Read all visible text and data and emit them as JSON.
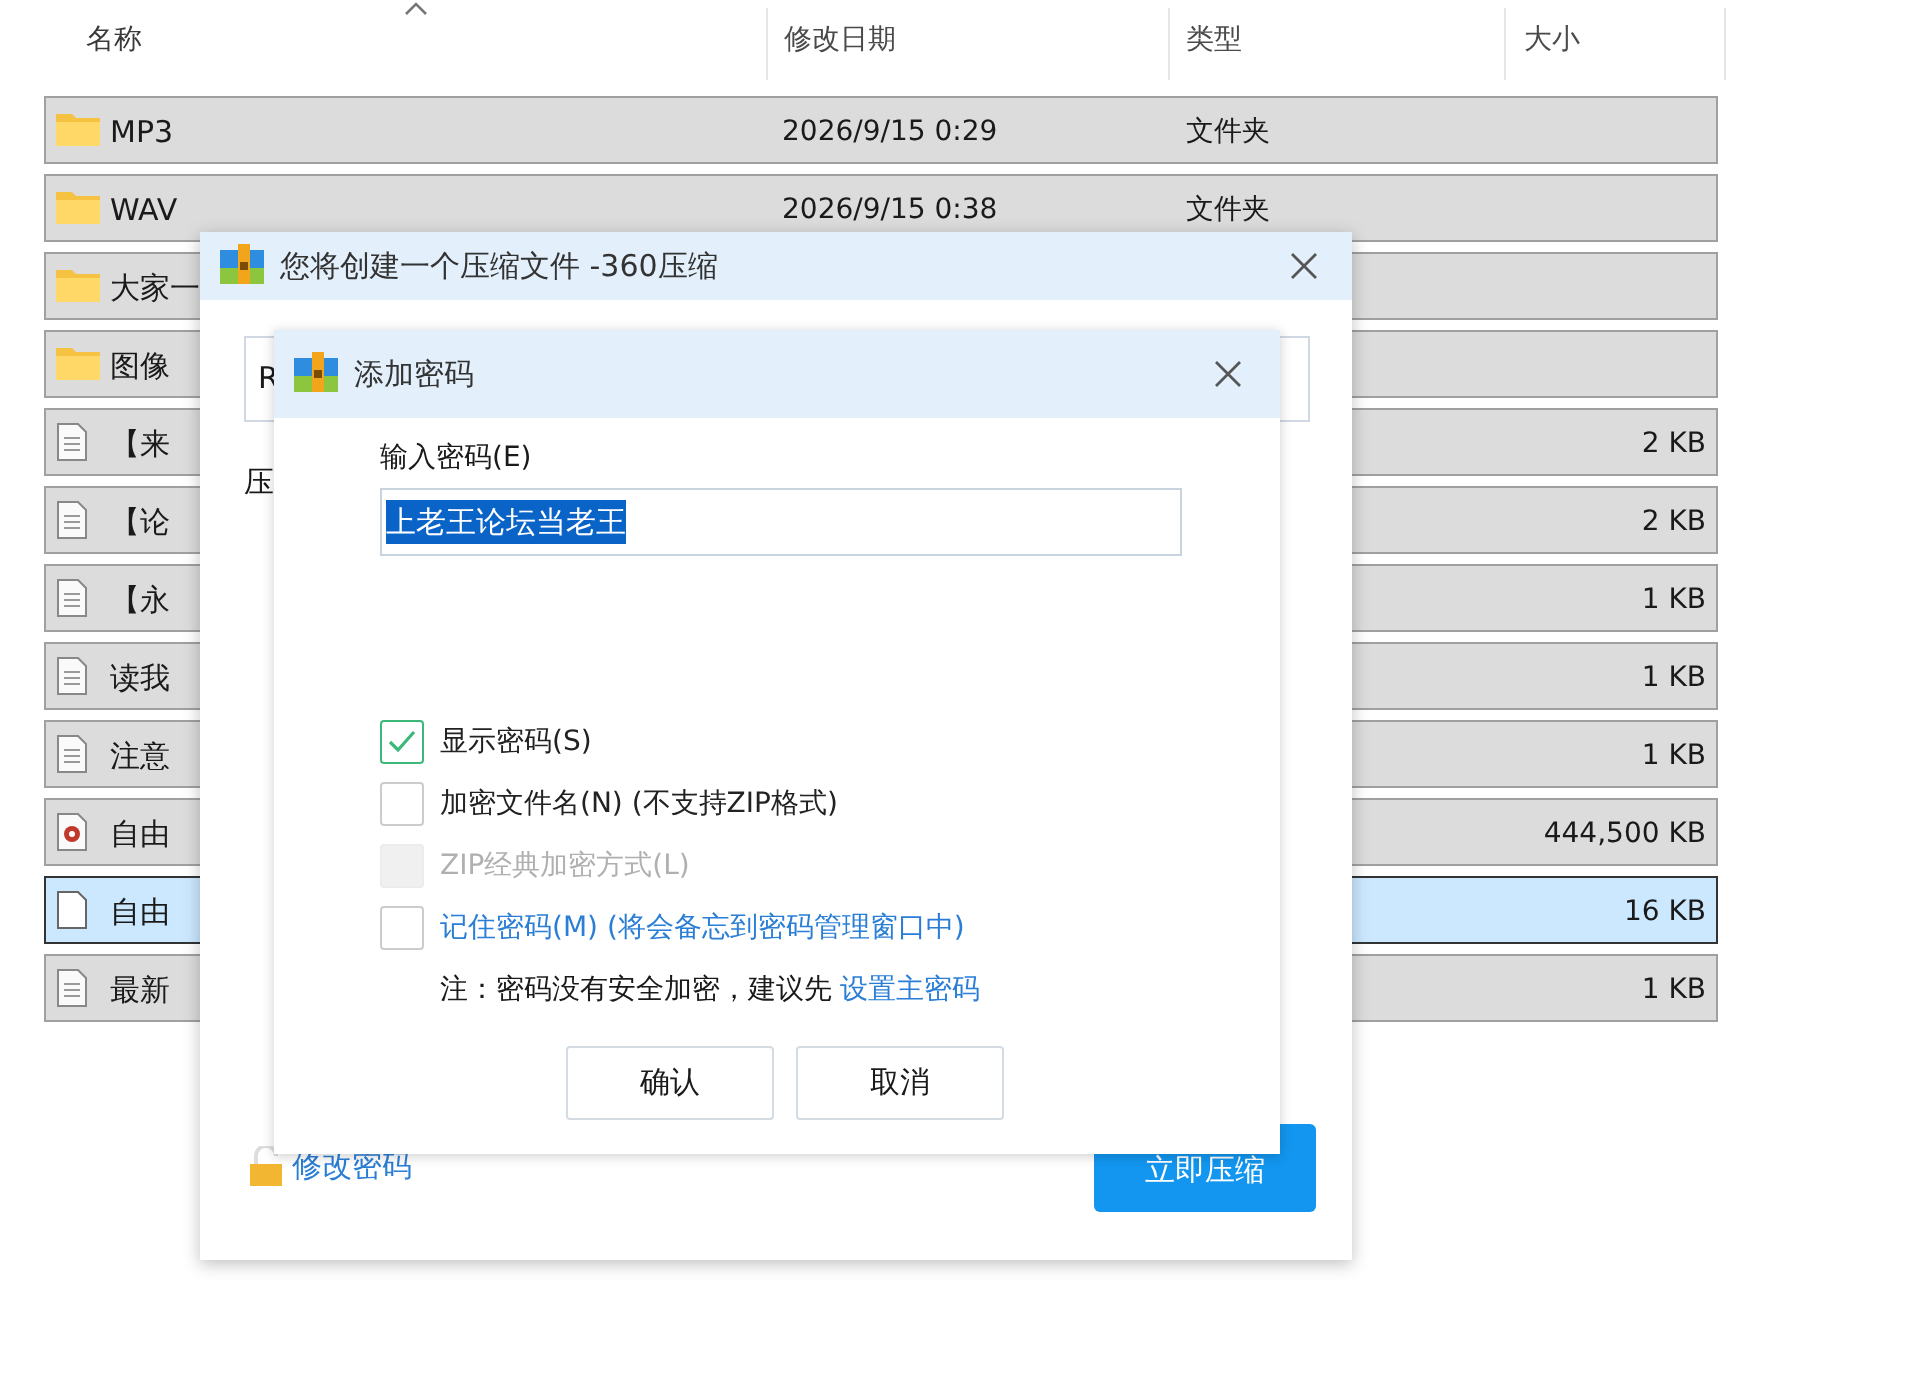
{
  "explorer": {
    "columns": [
      {
        "label": "名称",
        "sorted": true
      },
      {
        "label": "修改日期",
        "sorted": false
      },
      {
        "label": "类型",
        "sorted": false
      },
      {
        "label": "大小",
        "sorted": false
      }
    ],
    "rows": [
      {
        "kind": "folder",
        "name": "MP3",
        "date": "2026/9/15 0:29",
        "type": "文件夹",
        "selected": false
      },
      {
        "kind": "folder",
        "name": "WAV",
        "date": "2026/9/15 0:38",
        "type": "文件夹",
        "selected": false
      },
      {
        "kind": "folder",
        "name": "大家一",
        "selected": false
      },
      {
        "kind": "folder",
        "name": "图像",
        "selected": false
      },
      {
        "kind": "text",
        "name": "【来",
        "size": "2 KB",
        "selected": false
      },
      {
        "kind": "text",
        "name": "【论",
        "size": "2 KB",
        "selected": false
      },
      {
        "kind": "text",
        "name": "【永",
        "size": "1 KB",
        "selected": false
      },
      {
        "kind": "text",
        "name": "读我",
        "size": "1 KB",
        "selected": false
      },
      {
        "kind": "text",
        "name": "注意",
        "size": "1 KB",
        "selected": false
      },
      {
        "kind": "video",
        "name": "自由",
        "size": "444,500 KB",
        "selected": false
      },
      {
        "kind": "blank",
        "name": "自由",
        "size": "16 KB",
        "selected": true
      },
      {
        "kind": "text",
        "name": "最新",
        "size": "1 KB",
        "selected": false
      }
    ]
  },
  "compress_dialog": {
    "title": "您将创建一个压缩文件 -360压缩",
    "field_value": "R",
    "label": "压",
    "change_password_link": "修改密码",
    "compress_button": "立即压缩"
  },
  "password_dialog": {
    "title": "添加密码",
    "password_label": "输入密码(E)",
    "password": "上老王论坛当老王",
    "options": [
      {
        "kind": "plain",
        "label": "显示密码(S)",
        "checked": true,
        "disabled": false
      },
      {
        "kind": "plain",
        "label": "加密文件名(N) (不支持ZIP格式)",
        "checked": false,
        "disabled": false
      },
      {
        "kind": "plain",
        "label": "ZIP经典加密方式(L)",
        "checked": false,
        "disabled": true
      },
      {
        "kind": "link",
        "label": "记住密码(M) (将会备忘到密码管理窗口中)",
        "checked": false,
        "disabled": false
      }
    ],
    "note": "注：密码没有安全加密，建议先",
    "note_link": "设置主密码",
    "buttons": [
      "确认",
      "取消"
    ]
  }
}
